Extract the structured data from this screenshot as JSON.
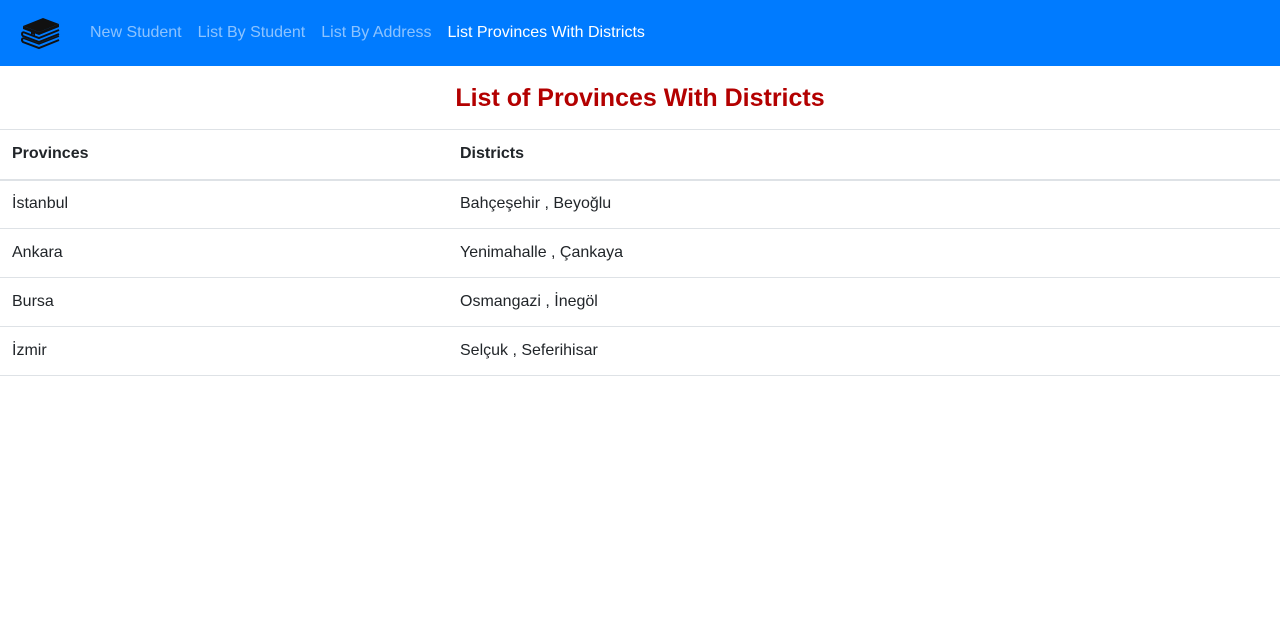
{
  "navbar": {
    "brand_icon": "books-stack-icon",
    "links": [
      {
        "label": "New Student",
        "active": false
      },
      {
        "label": "List By Student",
        "active": false
      },
      {
        "label": "List By Address",
        "active": false
      },
      {
        "label": "List Provinces With Districts",
        "active": true
      }
    ]
  },
  "page": {
    "title": "List of Provinces With Districts"
  },
  "table": {
    "headers": [
      "Provinces",
      "Districts"
    ],
    "rows": [
      [
        "İstanbul",
        "Bahçeşehir , Beyoğlu"
      ],
      [
        "Ankara",
        "Yenimahalle , Çankaya"
      ],
      [
        "Bursa",
        "Osmangazi , İnegöl"
      ],
      [
        "İzmir",
        "Selçuk , Seferihisar"
      ]
    ]
  },
  "colors": {
    "navbar_bg": "#007bff",
    "title": "#b30000"
  }
}
